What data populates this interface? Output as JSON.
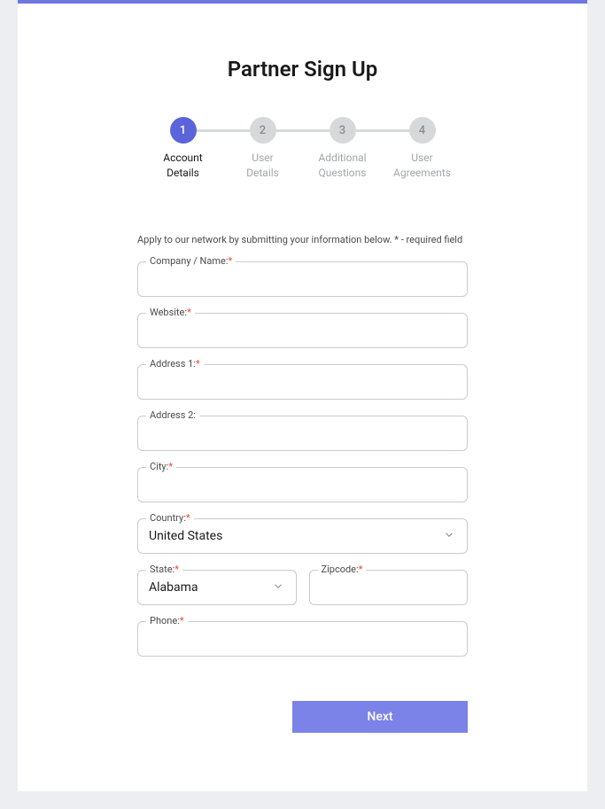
{
  "title": "Partner Sign Up",
  "steps": [
    {
      "num": "1",
      "label": "Account\nDetails",
      "active": true
    },
    {
      "num": "2",
      "label": "User\nDetails",
      "active": false
    },
    {
      "num": "3",
      "label": "Additional\nQuestions",
      "active": false
    },
    {
      "num": "4",
      "label": "User\nAgreements",
      "active": false
    }
  ],
  "instruction": "Apply to our network by submitting your information below. * - required field",
  "fields": {
    "company": {
      "label": "Company / Name:",
      "required": true,
      "value": ""
    },
    "website": {
      "label": "Website:",
      "required": true,
      "value": ""
    },
    "address1": {
      "label": "Address 1:",
      "required": true,
      "value": ""
    },
    "address2": {
      "label": "Address 2:",
      "required": false,
      "value": ""
    },
    "city": {
      "label": "City:",
      "required": true,
      "value": ""
    },
    "country": {
      "label": "Country:",
      "required": true,
      "value": "United States"
    },
    "state": {
      "label": "State:",
      "required": true,
      "value": "Alabama"
    },
    "zipcode": {
      "label": "Zipcode:",
      "required": true,
      "value": ""
    },
    "phone": {
      "label": "Phone:",
      "required": true,
      "value": ""
    }
  },
  "next_button": "Next",
  "required_marker": "*"
}
